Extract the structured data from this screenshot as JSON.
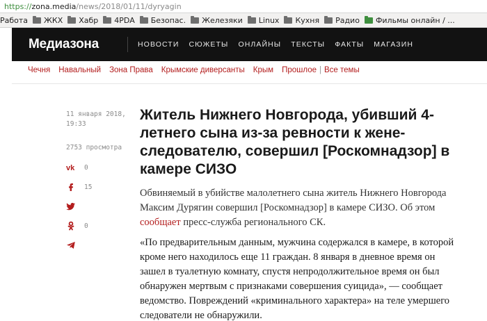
{
  "browser": {
    "url_scheme": "https://",
    "url_host": "zona.media",
    "url_path": "/news/2018/01/11/dyryagin",
    "bookmarks": [
      "Работа",
      "ЖКХ",
      "Хабр",
      "4PDA",
      "Безопас.",
      "Железяки",
      "Linux",
      "Кухня",
      "Радио",
      "Фильмы онлайн / ..."
    ]
  },
  "site": {
    "logo": "Медиазона",
    "nav": [
      "НОВОСТИ",
      "СЮЖЕТЫ",
      "ОНЛАЙНЫ",
      "ТЕКСТЫ",
      "ФАКТЫ",
      "МАГАЗИН"
    ],
    "tags": [
      "Чечня",
      "Навальный",
      "Зона Права",
      "Крымские диверсанты",
      "Крым",
      "Прошлое"
    ],
    "all_topics": "Все темы"
  },
  "article": {
    "date_line1": "11 января 2018,",
    "date_line2": "19:33",
    "views": "2753 просмотра",
    "shares": {
      "vk": "0",
      "facebook": "15",
      "odnoklassniki": "0"
    },
    "headline": "Житель Нижнего Новгорода, убивший 4-летнего сына из-за ревности к жене-следователю, совершил [Роскомнадзор] в камере СИЗО",
    "lead_before": "Обвиняемый в убийстве малолетнего сына житель Нижнего Новгорода Максим Дурягин совершил [Роскомнадзор] в камере СИЗО. Об этом ",
    "lead_link": "сообщает",
    "lead_after": " пресс-служба регионального СК.",
    "body": "«По предварительным данным, мужчина содержался в камере, в которой кроме него находилось еще 11 граждан. 8 января в дневное время он зашел в туалетную комнату, спустя непродолжительное время он был обнаружен мертвым с признаками совершения суицида», — сообщает ведомство. Повреждений «криминального характера» на теле умершего следователи не обнаружили."
  },
  "colors": {
    "accent": "#b31d1d",
    "header_bg": "#121212"
  }
}
